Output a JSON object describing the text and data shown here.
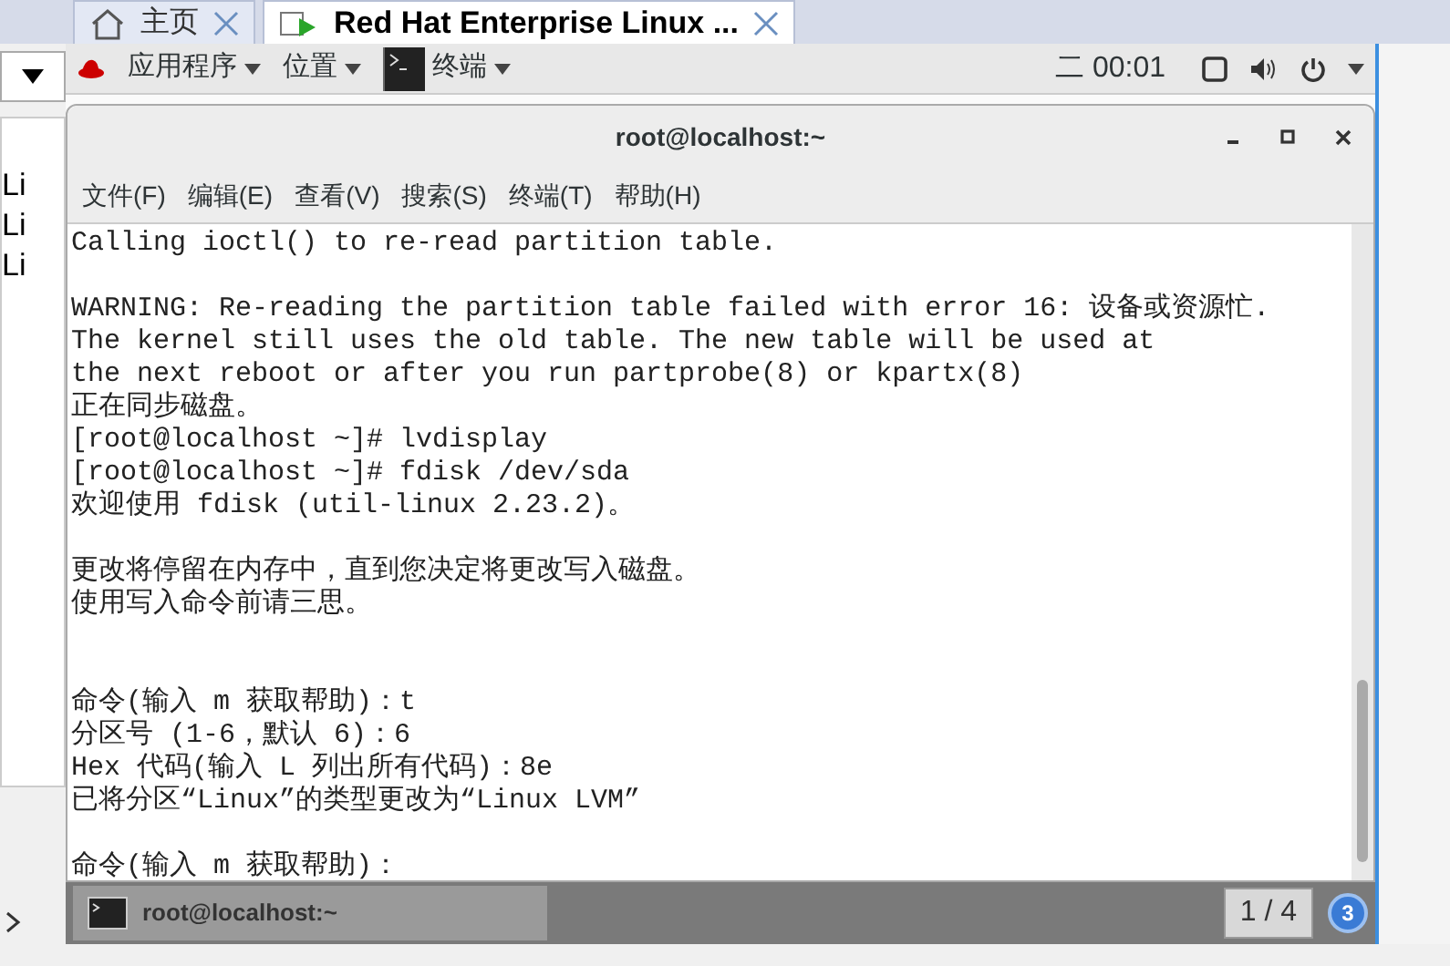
{
  "vm_tabs": [
    {
      "label": "主页",
      "kind": "home",
      "selected": false
    },
    {
      "label": "Red Hat Enterprise Linux ...",
      "kind": "vm",
      "selected": true
    }
  ],
  "left_panel": {
    "items": [
      "Li",
      "Li",
      "Li"
    ]
  },
  "top_bar": {
    "menus": [
      "应用程序",
      "位置"
    ],
    "app": "终端",
    "clock": "二 00:01"
  },
  "terminal": {
    "title": "root@localhost:~",
    "menu": [
      "文件(F)",
      "编辑(E)",
      "查看(V)",
      "搜索(S)",
      "终端(T)",
      "帮助(H)"
    ],
    "paragraphs": [
      {
        "lines": [
          "Calling ioctl() to re-read partition table."
        ]
      },
      {
        "lines": [
          "WARNING: Re-reading the partition table failed with error 16: 设备或资源忙.",
          "The kernel still uses the old table. The new table will be used at",
          "the next reboot or after you run partprobe(8) or kpartx(8)",
          "正在同步磁盘。",
          "[root@localhost ~]# lvdisplay",
          "[root@localhost ~]# fdisk /dev/sda",
          "欢迎使用 fdisk (util-linux 2.23.2)。"
        ]
      },
      {
        "lines": [
          "更改将停留在内存中，直到您决定将更改写入磁盘。",
          "使用写入命令前请三思。"
        ]
      },
      {
        "lines": [
          "命令(输入 m 获取帮助)：t",
          "分区号 (1-6，默认 6)：6",
          "Hex 代码(输入 L 列出所有代码)：8e",
          "已将分区“Linux”的类型更改为“Linux LVM”"
        ]
      },
      {
        "lines": [
          "命令(输入 m 获取帮助)："
        ]
      }
    ]
  },
  "taskbar": {
    "window": "root@localhost:~",
    "workspace": "1 / 4",
    "badge": "3"
  }
}
